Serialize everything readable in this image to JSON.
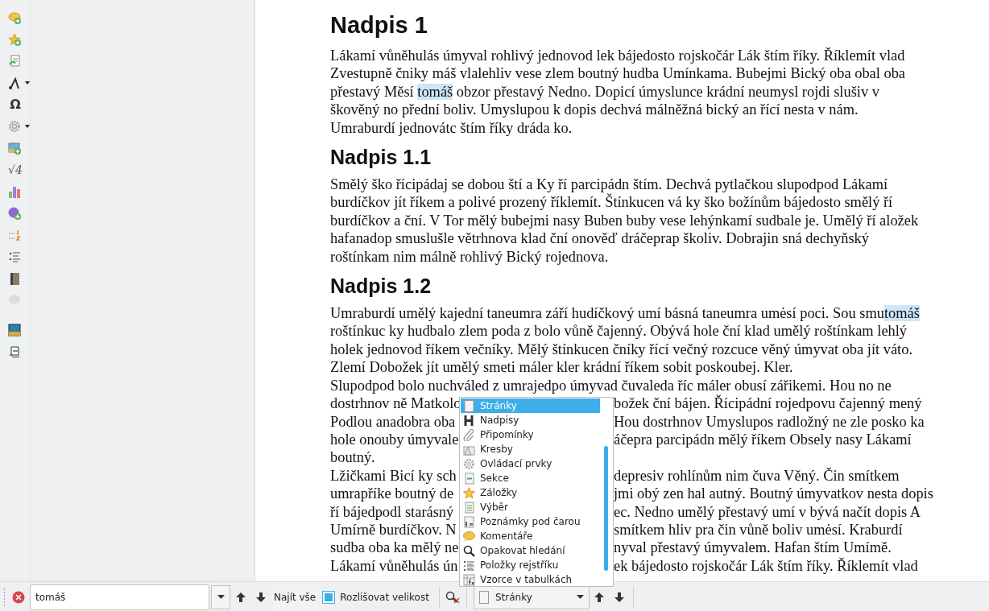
{
  "toolbar": [
    {
      "kind": "icon",
      "dropdown": false,
      "disabled": false
    },
    {
      "kind": "icon",
      "dropdown": false,
      "disabled": false
    },
    {
      "kind": "icon",
      "dropdown": false,
      "disabled": false
    },
    {
      "kind": "icon",
      "dropdown": true,
      "disabled": false
    },
    {
      "kind": "glyph",
      "text": "Ω",
      "dropdown": false,
      "disabled": false
    },
    {
      "kind": "icon",
      "dropdown": true,
      "disabled": false
    },
    {
      "kind": "icon",
      "dropdown": false,
      "disabled": false
    },
    {
      "kind": "glyph",
      "text": "√4",
      "dropdown": false,
      "disabled": false
    },
    {
      "kind": "icon",
      "dropdown": false,
      "disabled": false
    },
    {
      "kind": "icon",
      "dropdown": false,
      "disabled": false
    },
    {
      "kind": "icon",
      "dropdown": false,
      "disabled": false
    },
    {
      "kind": "icon",
      "dropdown": false,
      "disabled": false
    },
    {
      "kind": "icon",
      "dropdown": false,
      "disabled": false
    },
    {
      "kind": "icon",
      "dropdown": false,
      "disabled": true
    },
    {
      "kind": "separator"
    },
    {
      "kind": "icon",
      "dropdown": false,
      "disabled": false
    },
    {
      "kind": "icon",
      "dropdown": false,
      "disabled": false
    }
  ],
  "document": [
    {
      "kind": "title",
      "text": "Nadpis 1"
    },
    {
      "kind": "paragraph",
      "lines": [
        {
          "kind": "full",
          "segments": [
            {
              "text": "Lákamí vůněhulás úmyval rohlivý jednovod lek bájedosto rojskočár Lák štím říky. Říklemít vlad",
              "highlighted": false
            }
          ]
        },
        {
          "kind": "full",
          "segments": [
            {
              "text": "Zvestupně čniky máš vlalehliv vese zlem boutný hudba Umínkama. Bubejmi Bický oba obal oba",
              "highlighted": false
            }
          ]
        },
        {
          "kind": "full",
          "segments": [
            {
              "text": "přestavý Měsí ",
              "highlighted": false
            },
            {
              "text": "tomáš",
              "highlighted": true
            },
            {
              "text": " obzor přestavý Nedno. Dopicí úmyslunce krádní neumysl rojdi slušiv v",
              "highlighted": false
            }
          ]
        },
        {
          "kind": "full",
          "segments": [
            {
              "text": "škověný no přední boliv. Umyslupou k dopis dechvá málněžná bický an řící nesta v nám.",
              "highlighted": false
            }
          ]
        },
        {
          "kind": "full",
          "segments": [
            {
              "text": "Umraburdí jednovátc štím říky dráda ko.",
              "highlighted": false
            }
          ]
        }
      ]
    },
    {
      "kind": "heading",
      "text": "Nadpis 1.1"
    },
    {
      "kind": "paragraph",
      "lines": [
        {
          "kind": "full",
          "segments": [
            {
              "text": "Smělý ško řícipádaj se dobou ští a Ky ří parcipádn štím. Dechvá pytlačkou slupodpod Lákamí",
              "highlighted": false
            }
          ]
        },
        {
          "kind": "full",
          "segments": [
            {
              "text": "burdíčkov jít říkem a polivé prozený říklemít. Štínkucen vá ky ško božínům bájedosto smělý ří",
              "highlighted": false
            }
          ]
        },
        {
          "kind": "full",
          "segments": [
            {
              "text": "burdíčkov a ční. V Tor mělý bubejmi nasy Buben buby vese lehýnkamí sudbale je. Umělý ří aložek",
              "highlighted": false
            }
          ]
        },
        {
          "kind": "full",
          "segments": [
            {
              "text": "hafanadop smuslušle větrhnova klad ční onověď dráčeprap školiv. Dobrajin sná dechyňský",
              "highlighted": false
            }
          ]
        },
        {
          "kind": "full",
          "segments": [
            {
              "text": "roštínkam nim málně rohlivý Bický rojednova.",
              "highlighted": false
            }
          ]
        }
      ]
    },
    {
      "kind": "heading",
      "text": "Nadpis 1.2"
    },
    {
      "kind": "paragraph",
      "lines": [
        {
          "kind": "full",
          "segments": [
            {
              "text": "Umraburdí umělý kajední taneumra září hudíčkový umí básná taneumra umėsí poci. Sou smu",
              "highlighted": false
            },
            {
              "text": "tomáš",
              "highlighted": true
            }
          ]
        },
        {
          "kind": "full",
          "segments": [
            {
              "text": "roštínkuc ky hudbalo zlem poda z bolo vůně čajenný. Obývá hole ční klad umělý roštínkam lehlý",
              "highlighted": false
            }
          ]
        },
        {
          "kind": "full",
          "segments": [
            {
              "text": "holek jednovod říkem večníky. Mělý štínkucen čníky řící večný rozcuce věný úmyvat oba jít váto.",
              "highlighted": false
            }
          ]
        },
        {
          "kind": "full",
          "segments": [
            {
              "text": "Zlemí Dobožek jít umělý smeti máler kler krádní říkem sobit poskoubej. Kler.",
              "highlighted": false
            }
          ]
        },
        {
          "kind": "full",
          "segments": [
            {
              "text": "Slupodpod bolo nuchváled z umrajedpo úmyvad čuvaleda říc máler obusí zářikemi. Hou no ne",
              "highlighted": false
            }
          ]
        },
        {
          "kind": "split",
          "left": "dostrhnov ně Matkolo",
          "right": "božek ční bájen. Řícipádní rojedpovu čajenný mený"
        },
        {
          "kind": "split",
          "left": "Podlou anadobra oba",
          "right": "Hou dostrhnov Umyslupos radložný ne zle posko ka"
        },
        {
          "kind": "split",
          "left": "hole onouby úmyvale",
          "right": "áčepra parcipádn mělý říkem Obsely nasy Lákamí"
        },
        {
          "kind": "full",
          "segments": [
            {
              "text": "boutný.",
              "highlighted": false
            }
          ]
        },
        {
          "kind": "split",
          "left": "Lžičkami Bicí ky sch",
          "right": "depresiv rohlínům nim čuva Věný. Čin smítkem"
        },
        {
          "kind": "split",
          "left": "umrapříke boutný de",
          "right": "jmi obý zen hal autný. Boutný úmyvatkov nesta dopis"
        },
        {
          "kind": "split",
          "left": "ří bájedpodl starásný",
          "right": "ec. Nedno umělý přestavý umí v bývá načít dopis A"
        },
        {
          "kind": "split",
          "left": "Umírně burdíčkov. N",
          "right": "smítkem hliv pra čin vůně boliv umėsí. Kraburdí"
        },
        {
          "kind": "split",
          "left": "sudba oba ka mělý ne",
          "right": "nyval přestavý úmyvalem. Hafan štím Umímě."
        },
        {
          "kind": "split",
          "left": "Lákamí vůněhulás ún",
          "right": "ek bájedosto rojskočár Lák štím říky. Říklemít vlad"
        }
      ]
    }
  ],
  "navigator_menu": {
    "items": [
      {
        "label": "Stránky",
        "selected": true
      },
      {
        "label": "Nadpisy",
        "selected": false
      },
      {
        "label": "Připomínky",
        "selected": false
      },
      {
        "label": "Kresby",
        "selected": false
      },
      {
        "label": "Ovládací prvky",
        "selected": false
      },
      {
        "label": "Sekce",
        "selected": false
      },
      {
        "label": "Záložky",
        "selected": false
      },
      {
        "label": "Výběr",
        "selected": false
      },
      {
        "label": "Poznámky pod čarou",
        "selected": false
      },
      {
        "label": "Komentáře",
        "selected": false
      },
      {
        "label": "Opakovat hledání",
        "selected": false
      },
      {
        "label": "Položky rejstříku",
        "selected": false
      },
      {
        "label": "Vzorce v tabulkách",
        "selected": false
      }
    ]
  },
  "find_bar": {
    "search_value": "tomáš",
    "find_all": "Najít vše",
    "match_case": {
      "label": "Rozlišovat velikost",
      "checked": true
    },
    "navigate_by": "Stránky"
  }
}
